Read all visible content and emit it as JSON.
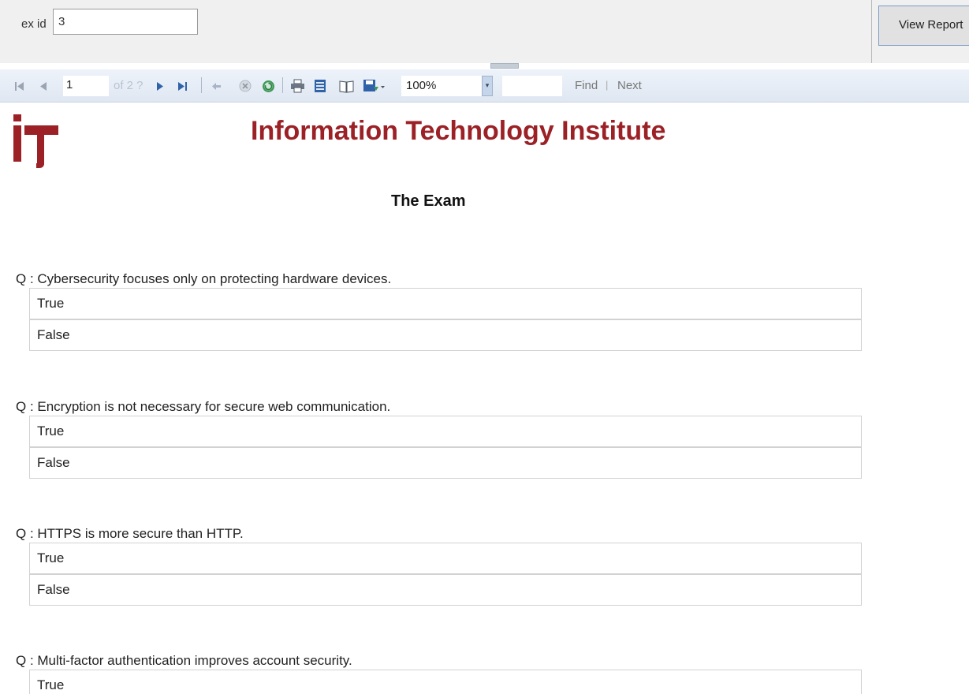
{
  "params": {
    "label": "ex id",
    "value": "3",
    "view_report_label": "View Report"
  },
  "toolbar": {
    "first_icon": "first-page-icon",
    "prev_icon": "previous-page-icon",
    "page": "1",
    "of_pages": "of 2 ?",
    "next_icon": "next-page-icon",
    "last_icon": "last-page-icon",
    "back_icon": "back-icon",
    "stop_icon": "stop-icon",
    "refresh_icon": "refresh-icon",
    "print_icon": "print-icon",
    "layout_icon": "print-layout-icon",
    "page_setup_icon": "page-setup-icon",
    "export_icon": "export-icon",
    "zoom": "100%",
    "find_label": "Find",
    "find_sep": "|",
    "next_label": "Next"
  },
  "report": {
    "logo_icon": "iti-logo",
    "institute": "Information Technology Institute",
    "exam_title": "The Exam",
    "questions": [
      {
        "text": "Q : Cybersecurity focuses only on protecting hardware devices.",
        "choices": [
          "True",
          "False"
        ]
      },
      {
        "text": "Q : Encryption is not necessary for secure web communication.",
        "choices": [
          "True",
          "False"
        ]
      },
      {
        "text": "Q : HTTPS is more secure than HTTP.",
        "choices": [
          "True",
          "False"
        ]
      },
      {
        "text": "Q : Multi-factor authentication improves account security.",
        "choices": [
          "True"
        ]
      }
    ]
  },
  "colors": {
    "brand": "#9b2126",
    "toolbar_icon": "#2f62a8"
  }
}
